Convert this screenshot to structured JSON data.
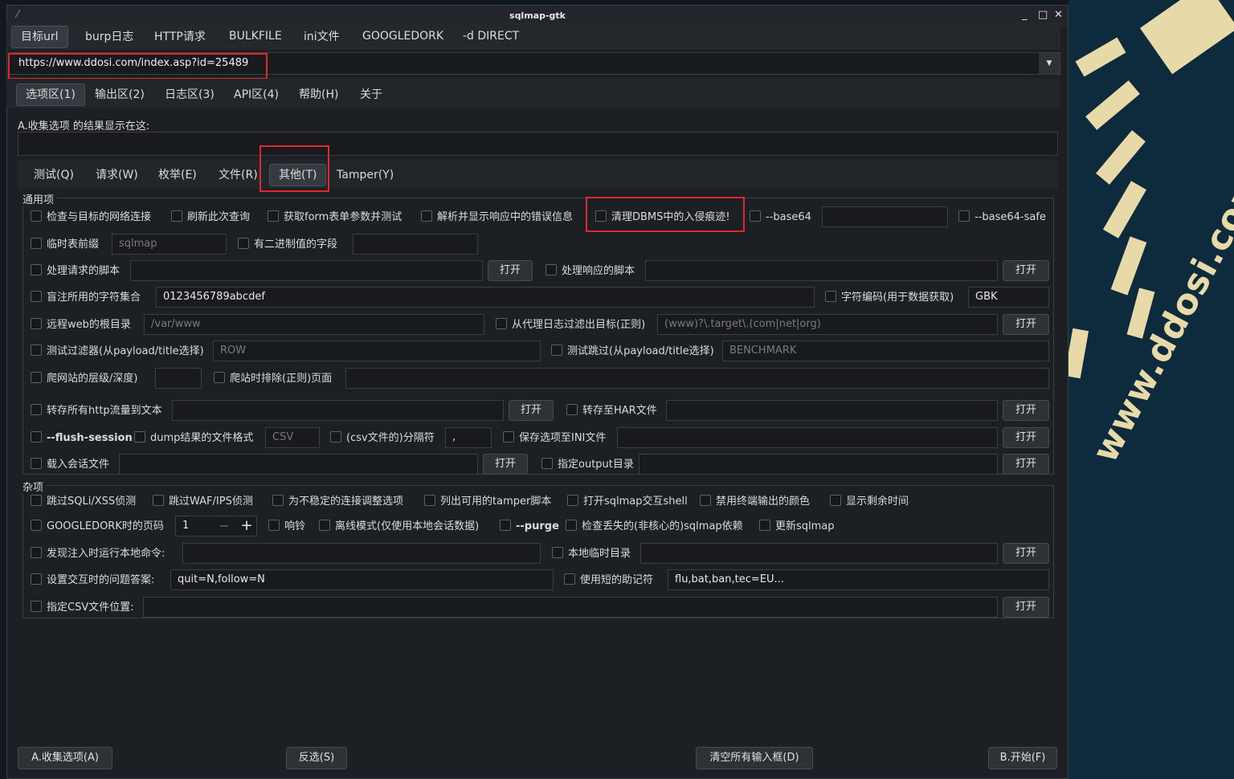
{
  "window": {
    "title": "sqlmap-gtk",
    "min": "_",
    "max": "□",
    "close": "✕"
  },
  "top_tabs": [
    "目标url",
    "burp日志",
    "HTTP请求",
    "BULKFILE",
    "ini文件",
    "GOOGLEDORK",
    "-d DIRECT"
  ],
  "url": {
    "value": "https://www.ddosi.com/index.asp?id=25489",
    "dropdown": "▼"
  },
  "area_tabs": [
    "选项区(1)",
    "输出区(2)",
    "日志区(3)",
    "API区(4)",
    "帮助(H)",
    "关于"
  ],
  "collect_label": "A.收集选项 的结果显示在这:",
  "option_tabs": [
    "测试(Q)",
    "请求(W)",
    "枚举(E)",
    "文件(R)",
    "其他(T)",
    "Tamper(Y)"
  ],
  "general": {
    "title": "通用项",
    "row1": [
      "检查与目标的网络连接",
      "刷新此次查询",
      "获取form表单参数并测试",
      "解析并显示响应中的错误信息",
      "清理DBMS中的入侵痕迹!",
      "--base64",
      "--base64-safe"
    ],
    "table_prefix": "临时表前缀",
    "table_prefix_ph": "sqlmap",
    "binary_fields": "有二进制值的字段",
    "req_script": "处理请求的脚本",
    "resp_script": "处理响应的脚本",
    "open": "打开",
    "charset": "盲注所用的字符集合",
    "charset_val": "0123456789abcdef",
    "encoding": "字符编码(用于数据获取)",
    "encoding_val": "GBK",
    "web_root": "远程web的根目录",
    "web_root_ph": "/var/www",
    "scope": "从代理日志过滤出目标(正则)",
    "scope_ph": "(www)?\\.target\\.(com|net|org)",
    "test_filter": "测试过滤器(从payload/title选择)",
    "test_filter_ph": "ROW",
    "test_skip": "测试跳过(从payload/title选择)",
    "test_skip_ph": "BENCHMARK",
    "crawl_depth": "爬网站的层级/深度)",
    "crawl_exclude": "爬站时排除(正则)页面",
    "traffic": "转存所有http流量到文本",
    "har": "转存至HAR文件",
    "flush": "--flush-session",
    "dump_format": "dump结果的文件格式",
    "dump_format_ph": "CSV",
    "csv_del": "(csv文件的)分隔符",
    "csv_del_val": ",",
    "save_ini": "保存选项至INI文件",
    "load_session": "载入会话文件",
    "output_dir": "指定output目录"
  },
  "misc": {
    "title": "杂项",
    "row1": [
      "跳过SQLi/XSS侦测",
      "跳过WAF/IPS侦测",
      "为不稳定的连接调整选项",
      "列出可用的tamper脚本",
      "打开sqlmap交互shell",
      "禁用终端输出的颜色",
      "显示剩余时间"
    ],
    "google_page": "GOOGLEDORK时的页码",
    "google_page_val": "1",
    "minus": "−",
    "plus": "+",
    "beep": "响铃",
    "offline": "离线模式(仅使用本地会话数据)",
    "purge": "--purge",
    "deps": "检查丢失的(非核心的)sqlmap依赖",
    "update": "更新sqlmap",
    "alert": "发现注入时运行本地命令:",
    "tmp_dir": "本地临时目录",
    "answers": "设置交互时的问题答案:",
    "answers_val": "quit=N,follow=N",
    "short": "使用短的助记符",
    "short_val": "flu,bat,ban,tec=EU...",
    "results_file": "指定CSV文件位置:"
  },
  "bottom": {
    "collect": "A.收集选项(A)",
    "invert": "反选(S)",
    "clear": "清空所有输入框(D)",
    "start": "B.开始(F)"
  },
  "watermark": "www.ddosi.com",
  "colors": {
    "highlight": "#e0282e",
    "window_bg": "#1c1f23",
    "desktop_bg": "#0e2a3d",
    "stripe": "#e8d9a8"
  }
}
